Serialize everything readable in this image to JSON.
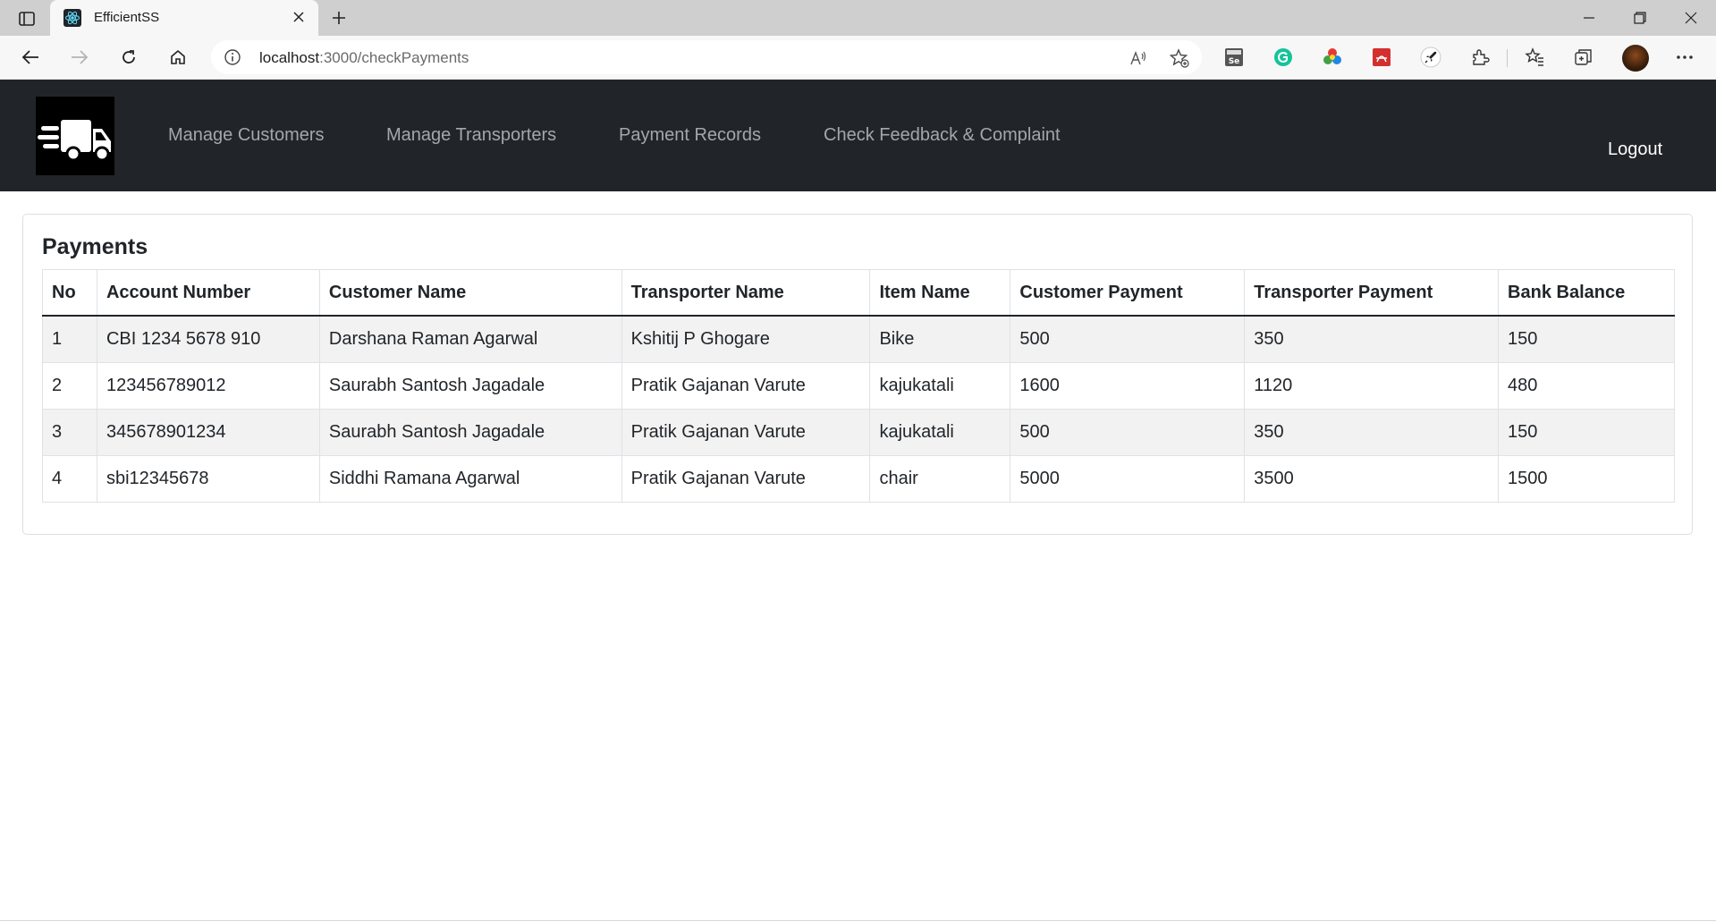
{
  "browser": {
    "tab_title": "EfficientSS",
    "url_host": "localhost",
    "url_path": ":3000/checkPayments"
  },
  "nav": {
    "links": [
      "Manage Customers",
      "Manage Transporters",
      "Payment Records",
      "Check Feedback & Complaint"
    ],
    "logout": "Logout",
    "logo_icon": "delivery-truck-icon"
  },
  "payments": {
    "title": "Payments",
    "headers": [
      "No",
      "Account Number",
      "Customer Name",
      "Transporter Name",
      "Item Name",
      "Customer Payment",
      "Transporter Payment",
      "Bank Balance"
    ],
    "rows": [
      [
        "1",
        "CBI 1234 5678 910",
        "Darshana Raman Agarwal",
        "Kshitij P Ghogare",
        "Bike",
        "500",
        "350",
        "150"
      ],
      [
        "2",
        "123456789012",
        "Saurabh Santosh Jagadale",
        "Pratik Gajanan Varute",
        "kajukatali",
        "1600",
        "1120",
        "480"
      ],
      [
        "3",
        "345678901234",
        "Saurabh Santosh Jagadale",
        "Pratik Gajanan Varute",
        "kajukatali",
        "500",
        "350",
        "150"
      ],
      [
        "4",
        "sbi12345678",
        "Siddhi Ramana Agarwal",
        "Pratik Gajanan Varute",
        "chair",
        "5000",
        "3500",
        "1500"
      ]
    ]
  },
  "colors": {
    "navbar_bg": "#212529",
    "nav_link": "#a4a7aa",
    "striped_row": "#f2f2f2"
  }
}
